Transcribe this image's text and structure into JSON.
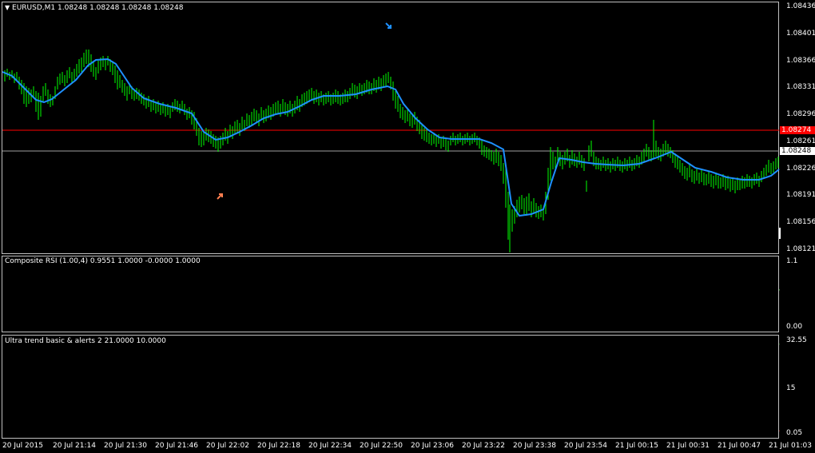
{
  "main": {
    "title": "EURUSD,M1  1.08248 1.08248 1.08248 1.08248",
    "price_axis": [
      "1.08436",
      "1.08401",
      "1.08366",
      "1.08331",
      "1.08296",
      "1.08261",
      "1.08226",
      "1.08191",
      "1.08156",
      "1.08121"
    ],
    "red_line_price": "1.08274",
    "bid_price": "1.08248",
    "colors": {
      "up_candle": "#00ff00",
      "ma_line": "#1e90ff",
      "red_line": "#ff0000",
      "bid_line": "#c0c0c0"
    }
  },
  "rsi": {
    "title": "Composite RSI (1.00,4) 0.9551 1.0000 -0.0000 1.0000",
    "axis": [
      "1.1",
      "0.00"
    ]
  },
  "ultra": {
    "title": "Ultra trend basic & alerts 2 21.0000 10.0000",
    "axis": [
      "32.55",
      "15",
      "0.05"
    ]
  },
  "time_axis": [
    "20 Jul 2015",
    "20 Jul 21:14",
    "20 Jul 21:30",
    "20 Jul 21:46",
    "20 Jul 22:02",
    "20 Jul 22:18",
    "20 Jul 22:34",
    "20 Jul 22:50",
    "20 Jul 23:06",
    "20 Jul 23:22",
    "20 Jul 23:38",
    "20 Jul 23:54",
    "21 Jul 00:15",
    "21 Jul 00:31",
    "21 Jul 00:47",
    "21 Jul 01:03"
  ]
}
